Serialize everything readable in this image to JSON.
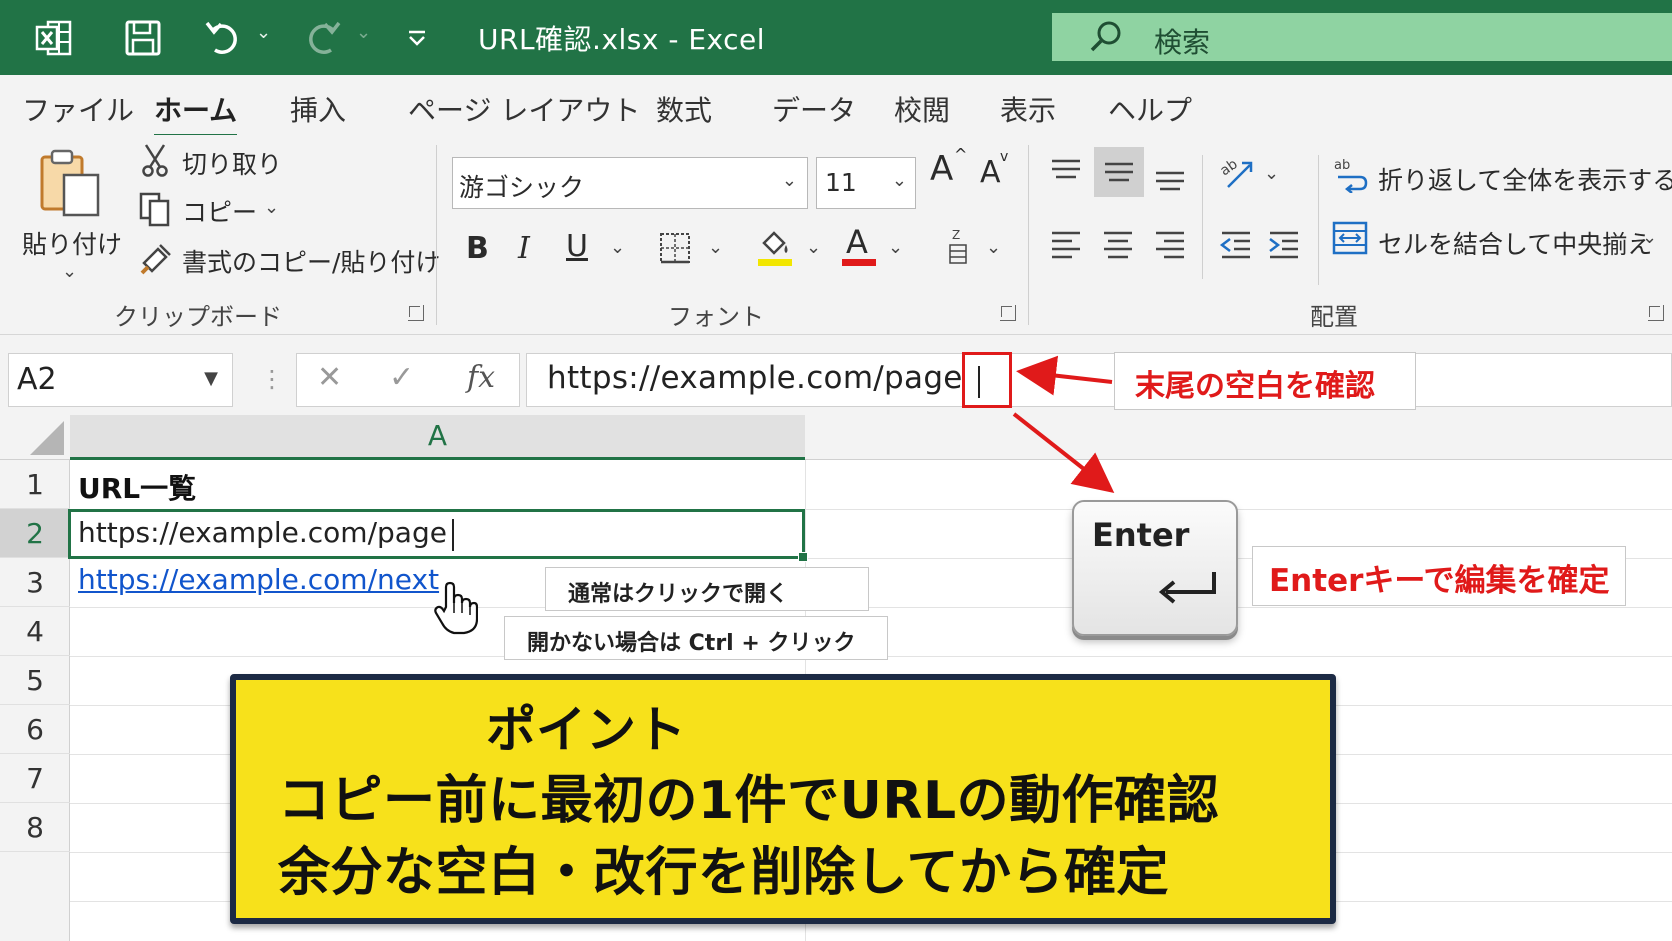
{
  "titlebar": {
    "title": "URL確認.xlsx  -  Excel",
    "search_placeholder": "検索"
  },
  "menu_tabs": [
    "ファイル",
    "ホーム",
    "挿入",
    "ページ レイアウト",
    "数式",
    "データ",
    "校閲",
    "表示",
    "ヘルプ"
  ],
  "ribbon": {
    "clipboard": {
      "paste_label": "貼り付け",
      "cut_label": "切り取り",
      "copy_label": "コピー",
      "format_painter_label": "書式のコピー/貼り付け",
      "group_label": "クリップボード"
    },
    "font": {
      "font_name": "游ゴシック",
      "font_size": "11",
      "bold": "B",
      "italic": "I",
      "underline": "U",
      "font_color_letter": "A",
      "grow_label": "A",
      "shrink_label": "A",
      "group_label": "フォント",
      "highlight_color": "#f2e600",
      "font_color": "#e01a1a"
    },
    "alignment": {
      "wrap_text_label": "折り返して全体を表示する",
      "merge_center_label": "セルを結合して中央揃え",
      "group_label": "配置"
    }
  },
  "formula_bar": {
    "name_box": "A2",
    "fx_label": "fx",
    "cancel_symbol": "✕",
    "enter_symbol": "✓",
    "formula_value": "https://example.com/page"
  },
  "grid": {
    "column_header": "A",
    "row_numbers": [
      "1",
      "2",
      "3",
      "4",
      "5",
      "6",
      "7",
      "8"
    ],
    "cells": {
      "a1": "URL一覧",
      "a2": "https://example.com/page",
      "a3": "https://example.com/next"
    },
    "link_color": "#1155cc"
  },
  "annotations": {
    "trailing_space_note": "末尾の空白を確認",
    "enter_key_label": "Enter",
    "enter_confirm_note": "Enterキーで編集を確定",
    "click_note": "通常はクリックで開く",
    "ctrl_click_note": "開かない場合は Ctrl + クリック",
    "point_title": "ポイント",
    "point_line1": "コピー前に最初の1件でURLの動作確認",
    "point_line2": "余分な空白・改行を削除してから確定",
    "accent_red": "#e01a1a",
    "point_bg": "#f7e11b"
  },
  "colors": {
    "excel_green": "#217346",
    "search_bg": "#8fd3a2"
  }
}
